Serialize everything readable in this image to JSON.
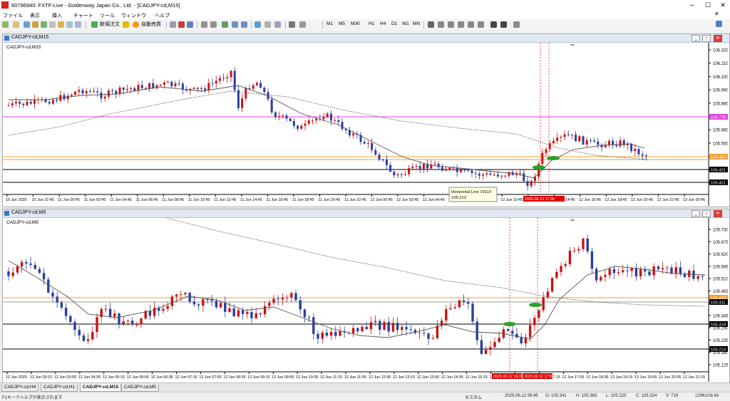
{
  "app": {
    "title": "60796940: FXTF-Live - Goldenway Japan Co., Ltd. - [CADJPY-cd,M15]"
  },
  "menu": [
    "ファイル",
    "表示",
    "挿入",
    "チャート",
    "ツール",
    "ウィンドウ",
    "ヘルプ"
  ],
  "toolbar": {
    "new_order": "新規注文",
    "auto_trade": "自動売買",
    "timeframes": [
      "M1",
      "M5",
      "M30",
      "H1",
      "H4",
      "D1",
      "W1",
      "MN"
    ]
  },
  "colors": {
    "bull": "#cc1111",
    "bear": "#2b3fa0",
    "ma_fast": "#555555",
    "ma_slow": "#444444",
    "horizontal": "#000000",
    "orange": "#f0a030",
    "magenta": "#e040e0",
    "vline": "#ff2020",
    "marker": "#2ca02c"
  },
  "upper": {
    "window_title": "CADJPY-cd,M15",
    "inner_label": "CADJPY-cd,M15",
    "price_labels": [
      "106.320",
      "106.210",
      "106.100",
      "105.990",
      "105.880",
      "105.770",
      "105.660",
      "105.550",
      "105.440",
      "105.329",
      "105.213"
    ],
    "xticks": [
      "10 Jun 2025",
      "10 Jun 22:45",
      "11 Jun 00:45",
      "11 Jun 02:45",
      "11 Jun 04:45",
      "11 Jun 06:45",
      "11 Jun 08:45",
      "11 Jun 10:45",
      "11 Jun 12:45",
      "11 Jun 14:45",
      "11 Jun 16:45",
      "11 Jun 18:45",
      "11 Jun 20:45",
      "11 Jun 22:45",
      "12 Jun 00:45",
      "12 Jun 02:45",
      "12 Jun 04:45",
      "12 Jun 06:45",
      "12 Jun 08:45",
      "12 Jun 10:45",
      "12 Jun 12:45",
      "12 Jun 14:45",
      "12 Jun 16:45",
      "12 Jun 18:45",
      "12 Jun 20:45",
      "12 Jun 22:45",
      "13 Jun 00:45"
    ],
    "tooltip": {
      "line1": "Horizontal Line 19110",
      "line2": "105.213"
    },
    "vtime_label": "2025.06.12 17:00",
    "badge_magenta": "105.770",
    "badge_orange": "105.463",
    "badge_bid": "105.421"
  },
  "lower": {
    "window_title": "CADJPY-cd,M5",
    "inner_label": "CADJPY-cd,M5",
    "price_labels": [
      "105.730",
      "105.675",
      "105.620",
      "105.565",
      "105.510",
      "105.455",
      "105.400",
      "105.345",
      "105.290",
      "105.235",
      "105.180",
      "105.125"
    ],
    "xticks": [
      "12 Jun 2025",
      "12 Jun 03:15",
      "12 Jun 03:55",
      "12 Jun 04:35",
      "12 Jun 05:15",
      "12 Jun 05:55",
      "12 Jun 06:35",
      "12 Jun 07:15",
      "12 Jun 07:55",
      "12 Jun 08:35",
      "12 Jun 09:15",
      "12 Jun 09:55",
      "12 Jun 10:35",
      "12 Jun 11:15",
      "12 Jun 11:55",
      "12 Jun 12:35",
      "12 Jun 13:15",
      "12 Jun 13:55",
      "12 Jun 14:35",
      "12 Jun 15:15",
      "12 Jun 15:55",
      "12 Jun 16:35",
      "12 Jun 17:15",
      "12 Jun 17:55",
      "12 Jun 18:35",
      "12 Jun 19:15",
      "12 Jun 19:55",
      "12 Jun 20:35",
      "12 Jun 21:15"
    ],
    "vtime_labels": [
      "2025.06.12 16:05",
      "2025.06.12 17:00"
    ],
    "badge_orange": "105.433",
    "badge_bid": "105.411",
    "badge_h1": "105.319",
    "badge_h2": "105.213"
  },
  "tabs": [
    "CADJPY-cd,H4",
    "CADJPY-cd,H1",
    "CADJPY-cd,M15",
    "CADJPY-cd,M5"
  ],
  "status": {
    "help": "F1キーでヘルプが表示されます",
    "profile": "カスタム",
    "time": "2025.06.12 08:45",
    "open": "O: 105.341",
    "high": "H: 105.363",
    "low": "L: 105.220",
    "close": "C: 105.324",
    "volume": "V: 719",
    "bytes": "12961/16 kb"
  }
}
